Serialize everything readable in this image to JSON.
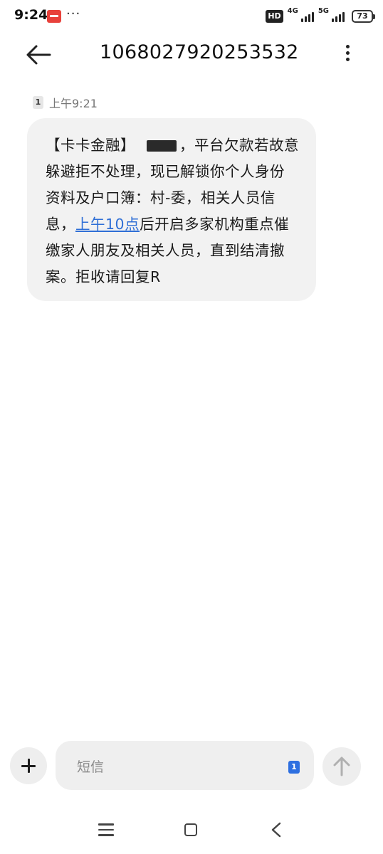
{
  "status_bar": {
    "time": "9:24",
    "dots": "···",
    "hd_label": "HD",
    "net_1": "4G",
    "net_2": "5G",
    "battery": "73"
  },
  "header": {
    "title": "1068027920253532",
    "back_icon": "arrow-left-icon",
    "more_icon": "vertical-dots-icon"
  },
  "message": {
    "sim": "1",
    "time": "上午9:21",
    "text_part1": "【卡卡金融】",
    "text_part2": "，平台欠款若故意躲避拒不处理，现已解锁你个人身份资料及户口簿：村-委，相关人员信息，",
    "link_text": "上午10点",
    "text_part3": "后开启多家机构重点催缴家人朋友及相关人员，直到结清撤案。拒收请回复R"
  },
  "composer": {
    "placeholder": "短信",
    "sim": "1",
    "add_icon": "plus-icon",
    "send_icon": "arrow-up-icon"
  },
  "navigation": {
    "menu_icon": "menu-icon",
    "home_icon": "home-square-icon",
    "back_icon": "back-chevron-icon"
  },
  "colors": {
    "bubble": "#f2f2f2",
    "link": "#2f6fd6",
    "sim_badge": "#2d6fe0"
  }
}
